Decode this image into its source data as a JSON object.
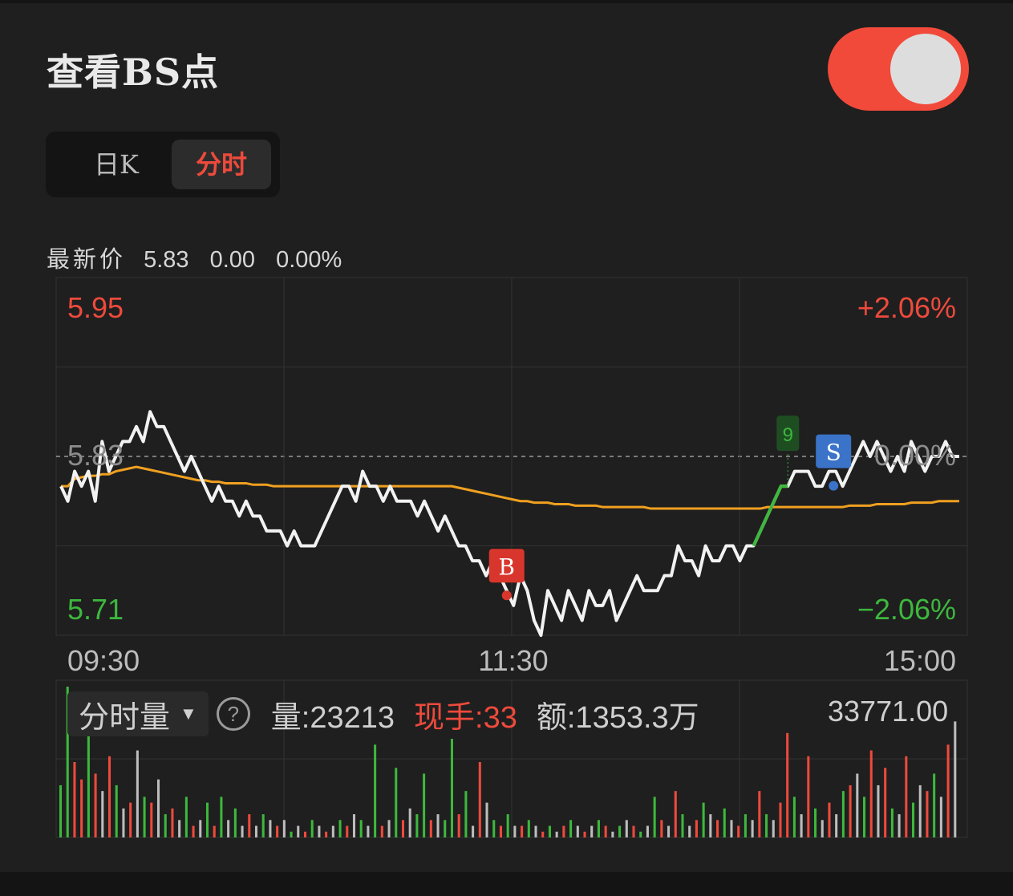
{
  "header": {
    "title": "查看BS点",
    "toggle_on": true
  },
  "tabs": [
    {
      "label": "日K",
      "active": false
    },
    {
      "label": "分时",
      "active": true
    }
  ],
  "price_bar": {
    "label": "最新价",
    "price": "5.83",
    "change": "0.00",
    "change_pct": "0.00%"
  },
  "colors": {
    "up": "#ee4a3c",
    "down": "#3db83d",
    "price_line": "#ffffff",
    "avg_line": "#f0a020",
    "buy": "#d8362c",
    "sell": "#3a73c8"
  },
  "chart_data": {
    "type": "line",
    "y_axis": {
      "top_label": "5.95",
      "mid_label": "5.83",
      "bottom_label": "5.71",
      "top_pct": "+2.06%",
      "mid_pct": "0.00%",
      "bottom_pct": "−2.06%",
      "ylim": [
        5.71,
        5.95
      ],
      "reference": 5.83
    },
    "x_axis": {
      "labels": [
        "09:30",
        "11:30",
        "15:00"
      ]
    },
    "grid": true,
    "price": [
      5.81,
      5.8,
      5.82,
      5.81,
      5.82,
      5.8,
      5.84,
      5.82,
      5.83,
      5.84,
      5.84,
      5.85,
      5.84,
      5.86,
      5.85,
      5.85,
      5.84,
      5.83,
      5.82,
      5.83,
      5.82,
      5.81,
      5.8,
      5.81,
      5.8,
      5.8,
      5.79,
      5.8,
      5.79,
      5.79,
      5.78,
      5.78,
      5.78,
      5.77,
      5.78,
      5.77,
      5.77,
      5.77,
      5.78,
      5.79,
      5.8,
      5.81,
      5.81,
      5.8,
      5.82,
      5.81,
      5.81,
      5.8,
      5.81,
      5.8,
      5.8,
      5.8,
      5.79,
      5.8,
      5.79,
      5.78,
      5.79,
      5.78,
      5.77,
      5.77,
      5.76,
      5.76,
      5.75,
      5.76,
      5.75,
      5.74,
      5.73,
      5.75,
      5.74,
      5.72,
      5.71,
      5.74,
      5.73,
      5.72,
      5.74,
      5.73,
      5.72,
      5.74,
      5.73,
      5.73,
      5.74,
      5.72,
      5.73,
      5.74,
      5.75,
      5.74,
      5.74,
      5.74,
      5.75,
      5.75,
      5.77,
      5.76,
      5.76,
      5.75,
      5.77,
      5.76,
      5.76,
      5.77,
      5.77,
      5.76,
      5.77,
      5.77,
      5.78,
      5.79,
      5.8,
      5.81,
      5.81,
      5.82,
      5.82,
      5.82,
      5.81,
      5.81,
      5.82,
      5.82,
      5.81,
      5.82,
      5.83,
      5.84,
      5.83,
      5.84,
      5.83,
      5.82,
      5.83,
      5.82,
      5.84,
      5.83,
      5.82,
      5.83,
      5.83,
      5.84,
      5.83,
      5.83
    ],
    "avg": [
      5.81,
      5.81,
      5.815,
      5.816,
      5.817,
      5.817,
      5.818,
      5.818,
      5.82,
      5.821,
      5.822,
      5.823,
      5.822,
      5.821,
      5.82,
      5.819,
      5.818,
      5.817,
      5.816,
      5.815,
      5.814,
      5.814,
      5.813,
      5.813,
      5.812,
      5.812,
      5.812,
      5.812,
      5.811,
      5.811,
      5.811,
      5.81,
      5.81,
      5.81,
      5.81,
      5.81,
      5.81,
      5.81,
      5.81,
      5.81,
      5.81,
      5.81,
      5.81,
      5.81,
      5.81,
      5.81,
      5.81,
      5.81,
      5.81,
      5.81,
      5.81,
      5.81,
      5.81,
      5.81,
      5.81,
      5.81,
      5.81,
      5.81,
      5.809,
      5.808,
      5.807,
      5.806,
      5.805,
      5.804,
      5.803,
      5.802,
      5.801,
      5.8,
      5.8,
      5.799,
      5.799,
      5.799,
      5.798,
      5.798,
      5.798,
      5.797,
      5.797,
      5.797,
      5.797,
      5.796,
      5.796,
      5.796,
      5.796,
      5.796,
      5.796,
      5.796,
      5.795,
      5.795,
      5.795,
      5.795,
      5.795,
      5.795,
      5.795,
      5.795,
      5.795,
      5.795,
      5.795,
      5.795,
      5.795,
      5.795,
      5.795,
      5.795,
      5.795,
      5.796,
      5.796,
      5.796,
      5.796,
      5.796,
      5.796,
      5.796,
      5.796,
      5.796,
      5.796,
      5.796,
      5.796,
      5.797,
      5.797,
      5.797,
      5.797,
      5.798,
      5.798,
      5.798,
      5.798,
      5.798,
      5.799,
      5.799,
      5.799,
      5.799,
      5.8,
      5.8,
      5.8,
      5.8
    ],
    "markers": [
      {
        "type": "buy",
        "label": "B",
        "index": 65
      },
      {
        "type": "sell",
        "label": "S",
        "index": 115
      },
      {
        "type": "count",
        "label": "9",
        "index": 106
      }
    ]
  },
  "volume": {
    "selector_label": "分时量",
    "help_icon": "question-circle-icon",
    "vol_label": "量:23213",
    "hand_label": "现手:",
    "hand_value": "33",
    "amount_label": "额:1353.3万",
    "max_label": "33771.00",
    "bars": [
      {
        "v": 9,
        "c": "g"
      },
      {
        "v": 26,
        "c": "g"
      },
      {
        "v": 13,
        "c": "r"
      },
      {
        "v": 10,
        "c": "r"
      },
      {
        "v": 19,
        "c": "g"
      },
      {
        "v": 11,
        "c": "r"
      },
      {
        "v": 8,
        "c": "w"
      },
      {
        "v": 14,
        "c": "r"
      },
      {
        "v": 9,
        "c": "g"
      },
      {
        "v": 5,
        "c": "w"
      },
      {
        "v": 6,
        "c": "r"
      },
      {
        "v": 15,
        "c": "w"
      },
      {
        "v": 7,
        "c": "g"
      },
      {
        "v": 6,
        "c": "r"
      },
      {
        "v": 10,
        "c": "w"
      },
      {
        "v": 4,
        "c": "g"
      },
      {
        "v": 5,
        "c": "r"
      },
      {
        "v": 3,
        "c": "w"
      },
      {
        "v": 7,
        "c": "g"
      },
      {
        "v": 2,
        "c": "r"
      },
      {
        "v": 3,
        "c": "w"
      },
      {
        "v": 6,
        "c": "g"
      },
      {
        "v": 2,
        "c": "r"
      },
      {
        "v": 7,
        "c": "g"
      },
      {
        "v": 3,
        "c": "w"
      },
      {
        "v": 5,
        "c": "g"
      },
      {
        "v": 2,
        "c": "w"
      },
      {
        "v": 4,
        "c": "r"
      },
      {
        "v": 2,
        "c": "w"
      },
      {
        "v": 4,
        "c": "g"
      },
      {
        "v": 3,
        "c": "w"
      },
      {
        "v": 2,
        "c": "r"
      },
      {
        "v": 3,
        "c": "w"
      },
      {
        "v": 1,
        "c": "g"
      },
      {
        "v": 2,
        "c": "w"
      },
      {
        "v": 1,
        "c": "r"
      },
      {
        "v": 3,
        "c": "g"
      },
      {
        "v": 2,
        "c": "w"
      },
      {
        "v": 1,
        "c": "r"
      },
      {
        "v": 2,
        "c": "w"
      },
      {
        "v": 3,
        "c": "g"
      },
      {
        "v": 2,
        "c": "r"
      },
      {
        "v": 4,
        "c": "w"
      },
      {
        "v": 3,
        "c": "g"
      },
      {
        "v": 2,
        "c": "w"
      },
      {
        "v": 16,
        "c": "g"
      },
      {
        "v": 2,
        "c": "r"
      },
      {
        "v": 3,
        "c": "w"
      },
      {
        "v": 12,
        "c": "g"
      },
      {
        "v": 3,
        "c": "r"
      },
      {
        "v": 5,
        "c": "w"
      },
      {
        "v": 4,
        "c": "g"
      },
      {
        "v": 11,
        "c": "g"
      },
      {
        "v": 3,
        "c": "r"
      },
      {
        "v": 4,
        "c": "w"
      },
      {
        "v": 3,
        "c": "g"
      },
      {
        "v": 17,
        "c": "g"
      },
      {
        "v": 4,
        "c": "r"
      },
      {
        "v": 8,
        "c": "g"
      },
      {
        "v": 2,
        "c": "w"
      },
      {
        "v": 13,
        "c": "r"
      },
      {
        "v": 6,
        "c": "w"
      },
      {
        "v": 3,
        "c": "g"
      },
      {
        "v": 2,
        "c": "r"
      },
      {
        "v": 4,
        "c": "g"
      },
      {
        "v": 2,
        "c": "w"
      },
      {
        "v": 2,
        "c": "r"
      },
      {
        "v": 3,
        "c": "g"
      },
      {
        "v": 2,
        "c": "w"
      },
      {
        "v": 1,
        "c": "r"
      },
      {
        "v": 2,
        "c": "g"
      },
      {
        "v": 1,
        "c": "w"
      },
      {
        "v": 2,
        "c": "r"
      },
      {
        "v": 3,
        "c": "g"
      },
      {
        "v": 2,
        "c": "w"
      },
      {
        "v": 1,
        "c": "r"
      },
      {
        "v": 2,
        "c": "w"
      },
      {
        "v": 3,
        "c": "g"
      },
      {
        "v": 2,
        "c": "r"
      },
      {
        "v": 1,
        "c": "w"
      },
      {
        "v": 2,
        "c": "g"
      },
      {
        "v": 3,
        "c": "w"
      },
      {
        "v": 2,
        "c": "r"
      },
      {
        "v": 1,
        "c": "g"
      },
      {
        "v": 2,
        "c": "w"
      },
      {
        "v": 7,
        "c": "g"
      },
      {
        "v": 3,
        "c": "r"
      },
      {
        "v": 2,
        "c": "w"
      },
      {
        "v": 8,
        "c": "r"
      },
      {
        "v": 4,
        "c": "g"
      },
      {
        "v": 2,
        "c": "w"
      },
      {
        "v": 3,
        "c": "r"
      },
      {
        "v": 6,
        "c": "g"
      },
      {
        "v": 4,
        "c": "w"
      },
      {
        "v": 3,
        "c": "r"
      },
      {
        "v": 5,
        "c": "g"
      },
      {
        "v": 3,
        "c": "w"
      },
      {
        "v": 2,
        "c": "r"
      },
      {
        "v": 4,
        "c": "g"
      },
      {
        "v": 3,
        "c": "w"
      },
      {
        "v": 8,
        "c": "r"
      },
      {
        "v": 4,
        "c": "g"
      },
      {
        "v": 3,
        "c": "w"
      },
      {
        "v": 6,
        "c": "r"
      },
      {
        "v": 18,
        "c": "r"
      },
      {
        "v": 7,
        "c": "g"
      },
      {
        "v": 4,
        "c": "w"
      },
      {
        "v": 14,
        "c": "r"
      },
      {
        "v": 5,
        "c": "g"
      },
      {
        "v": 3,
        "c": "w"
      },
      {
        "v": 6,
        "c": "r"
      },
      {
        "v": 4,
        "c": "w"
      },
      {
        "v": 8,
        "c": "g"
      },
      {
        "v": 9,
        "c": "r"
      },
      {
        "v": 11,
        "c": "w"
      },
      {
        "v": 7,
        "c": "g"
      },
      {
        "v": 15,
        "c": "r"
      },
      {
        "v": 9,
        "c": "w"
      },
      {
        "v": 12,
        "c": "r"
      },
      {
        "v": 5,
        "c": "g"
      },
      {
        "v": 4,
        "c": "w"
      },
      {
        "v": 14,
        "c": "r"
      },
      {
        "v": 6,
        "c": "g"
      },
      {
        "v": 9,
        "c": "w"
      },
      {
        "v": 8,
        "c": "r"
      },
      {
        "v": 11,
        "c": "g"
      },
      {
        "v": 7,
        "c": "w"
      },
      {
        "v": 16,
        "c": "r"
      },
      {
        "v": 20,
        "c": "w"
      }
    ]
  }
}
